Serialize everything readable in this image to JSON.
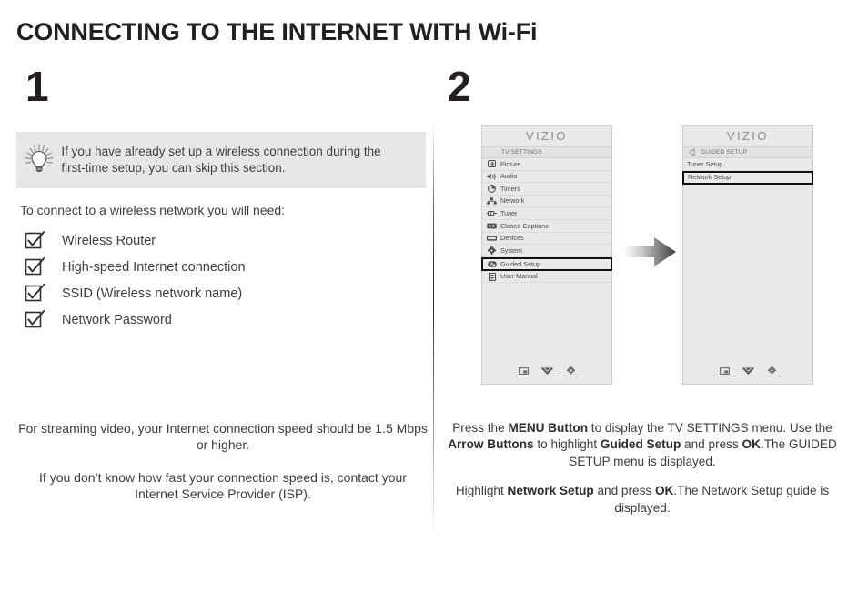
{
  "title": "CONNECTING TO THE INTERNET WITH Wi-Fi",
  "steps": {
    "one": "1",
    "two": "2"
  },
  "note": {
    "icon": "lightbulb-icon",
    "text": "If you have already set up a wireless connection during the first-time setup, you can skip this section."
  },
  "intro": "To connect to a wireless network you will need:",
  "checklist": [
    {
      "label": "Wireless Router"
    },
    {
      "label": "High-speed Internet connection"
    },
    {
      "label": "SSID (Wireless network name)"
    },
    {
      "label": "Network Password"
    }
  ],
  "left_notes": [
    "For streaming video, your Internet connection speed should be 1.5 Mbps or higher.",
    "If you don’t know how fast your connection speed is, contact your Internet Service Provider (ISP)."
  ],
  "tv_panel_1": {
    "logo": "VIZIO",
    "subhead": "TV SETTINGS",
    "rows": [
      {
        "label": "Picture",
        "icon": "picture-icon"
      },
      {
        "label": "Audio",
        "icon": "audio-icon"
      },
      {
        "label": "Timers",
        "icon": "clock-icon"
      },
      {
        "label": "Network",
        "icon": "network-icon"
      },
      {
        "label": "Tuner",
        "icon": "tuner-icon"
      },
      {
        "label": "Closed Captions",
        "icon": "closed-captions-icon"
      },
      {
        "label": "Devices",
        "icon": "devices-icon"
      },
      {
        "label": "System",
        "icon": "gear-icon"
      },
      {
        "label": "Guided Setup",
        "icon": "guided-setup-icon",
        "highlighted": true
      },
      {
        "label": "User Manual",
        "icon": "book-icon"
      }
    ],
    "footer_icons": [
      "picture-in-picture-icon",
      "double-chevron-down-icon",
      "gear-icon"
    ]
  },
  "tv_panel_2": {
    "logo": "VIZIO",
    "subhead": "GUIDED SETUP",
    "back_icon": "back-arrow-icon",
    "rows": [
      {
        "label": "Tuner Setup"
      },
      {
        "label": "Network Setup",
        "highlighted": true
      }
    ],
    "footer_icons": [
      "picture-in-picture-icon",
      "double-chevron-down-icon",
      "gear-icon"
    ]
  },
  "flow_arrow_icon": "right-arrow-icon",
  "right_notes": [
    [
      {
        "t": "Press the ",
        "b": false
      },
      {
        "t": "MENU Button",
        "b": true
      },
      {
        "t": " to display the TV SETTINGS menu. Use the ",
        "b": false
      },
      {
        "t": "Arrow Buttons",
        "b": true
      },
      {
        "t": " to highlight ",
        "b": false
      },
      {
        "t": "Guided Setup",
        "b": true
      },
      {
        "t": " and press ",
        "b": false
      },
      {
        "t": "OK",
        "b": true
      },
      {
        "t": ".The GUIDED SETUP menu is displayed.",
        "b": false
      }
    ],
    [
      {
        "t": "Highlight ",
        "b": false
      },
      {
        "t": "Network Setup",
        "b": true
      },
      {
        "t": " and press ",
        "b": false
      },
      {
        "t": "OK",
        "b": true
      },
      {
        "t": ".The Network Setup guide is displayed.",
        "b": false
      }
    ]
  ],
  "colors": {
    "title": "#231f20",
    "body_text": "#3d3d3d",
    "note_bg": "#e7e7e7",
    "panel_bg": "#e9e9e9",
    "panel_border": "#cfcfcf",
    "logo_gray": "#8e8e8e",
    "highlight_border": "#111111"
  }
}
